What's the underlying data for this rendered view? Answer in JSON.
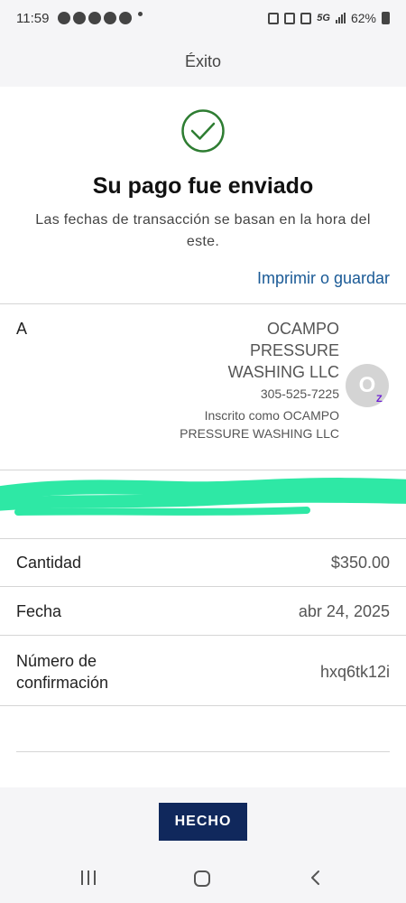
{
  "status_bar": {
    "time": "11:59",
    "network": "5G",
    "battery": "62%"
  },
  "header": {
    "title": "Éxito"
  },
  "confirmation": {
    "icon": "check-circle-icon",
    "title": "Su pago fue enviado",
    "subtitle": "Las fechas de transacción se basan en la hora del este.",
    "print_link": "Imprimir o guardar"
  },
  "recipient": {
    "label": "A",
    "name": "OCAMPO PRESSURE WASHING LLC",
    "phone": "305-525-7225",
    "enrolled": "Inscrito como OCAMPO PRESSURE WASHING LLC",
    "avatar_initial": "O",
    "badge": "Z"
  },
  "details": {
    "amount_label": "Cantidad",
    "amount_value": "$350.00",
    "date_label": "Fecha",
    "date_value": "abr 24, 2025",
    "confirmation_label": "Número de confirmación",
    "confirmation_value": "hxq6tk12i"
  },
  "footer": {
    "done_label": "HECHO"
  },
  "colors": {
    "accent": "#1a5a96",
    "button": "#10285c",
    "success": "#2e7d32",
    "redaction": "#2ee8a5"
  }
}
